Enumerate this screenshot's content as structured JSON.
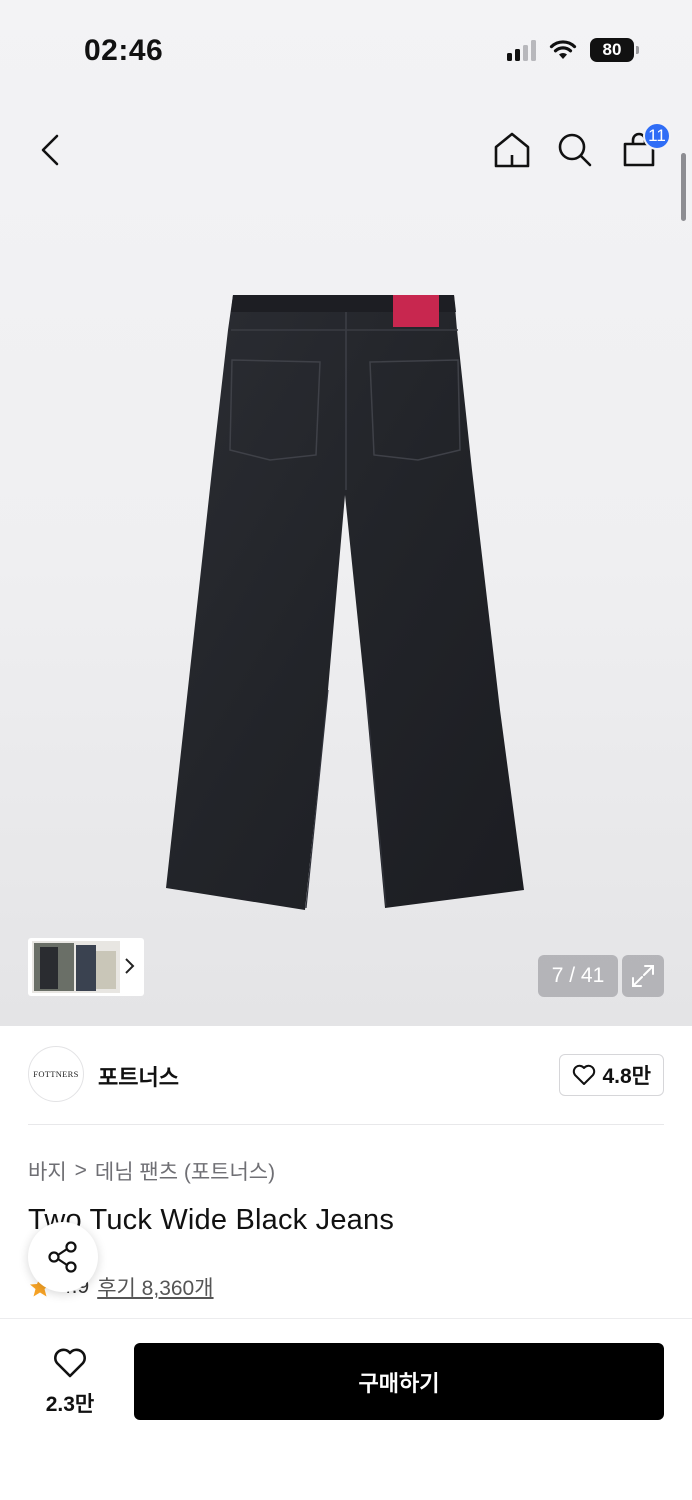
{
  "status_bar": {
    "time": "02:46",
    "battery": "80"
  },
  "header": {
    "cart_count": "11",
    "icons": [
      "back-icon",
      "home-icon",
      "search-icon",
      "cart-icon"
    ]
  },
  "gallery": {
    "counter": "7 / 41"
  },
  "brand": {
    "logo_text": "FOTTNERS",
    "name": "포트너스",
    "likes": "4.8만"
  },
  "breadcrumb": {
    "level1": "바지",
    "separator": ">",
    "level2": "데님 팬츠 (포트너스)"
  },
  "product": {
    "title": "Two Tuck Wide Black Jeans",
    "rating": "4.9",
    "reviews": "후기 8,360개"
  },
  "bottom_bar": {
    "like_count": "2.3만",
    "buy_label": "구매하기"
  },
  "colors": {
    "badge": "#2f6df6",
    "star": "#f7a325",
    "buy_button": "#000000",
    "label_patch": "#c8274f"
  }
}
